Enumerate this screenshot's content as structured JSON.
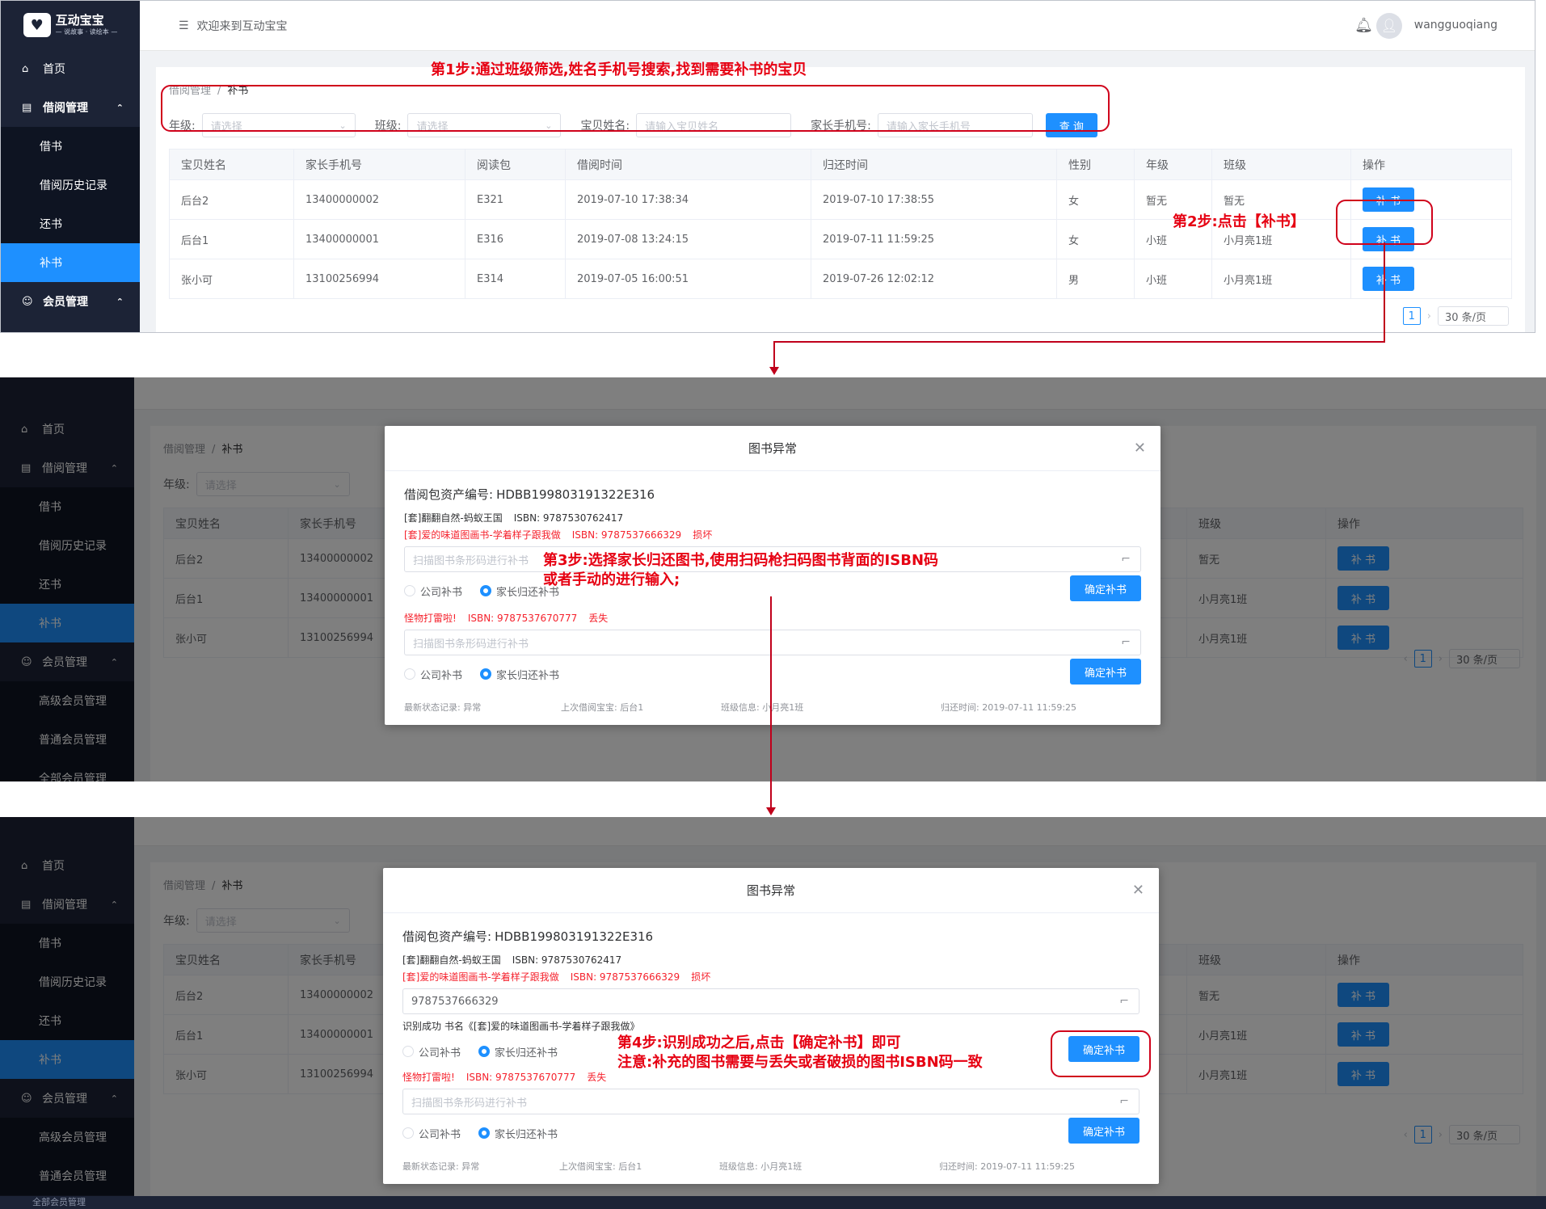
{
  "app": {
    "name": "互动宝宝",
    "slogan": "— 说故事 · 读绘本 —"
  },
  "topbar": {
    "welcome": "欢迎来到互动宝宝",
    "user": "wangguoqiang"
  },
  "sidebar": {
    "home": "首页",
    "borrow": "借阅管理",
    "borrow_sub": [
      "借书",
      "借阅历史记录",
      "还书",
      "补书"
    ],
    "member": "会员管理",
    "member_sub": [
      "高级会员管理",
      "普通会员管理",
      "全部会员管理"
    ]
  },
  "breadcrumb": {
    "parent": "借阅管理",
    "current": "补书",
    "sep": "/"
  },
  "filters": {
    "grade_label": "年级:",
    "grade_placeholder": "请选择",
    "class_label": "班级:",
    "class_placeholder": "请选择",
    "name_label": "宝贝姓名:",
    "name_placeholder": "请输入宝贝姓名",
    "phone_label": "家长手机号:",
    "phone_placeholder": "请输入家长手机号",
    "query": "查 询"
  },
  "table": {
    "headers": [
      "宝贝姓名",
      "家长手机号",
      "阅读包",
      "借阅时间",
      "归还时间",
      "性别",
      "年级",
      "班级",
      "操作"
    ],
    "rows": [
      {
        "name": "后台2",
        "phone": "13400000002",
        "pkg": "E321",
        "borrow": "2019-07-10 17:38:34",
        "return": "2019-07-10 17:38:55",
        "gender": "女",
        "grade": "暂无",
        "class": "暂无",
        "action": "补 书"
      },
      {
        "name": "后台1",
        "phone": "13400000001",
        "pkg": "E316",
        "borrow": "2019-07-08 13:24:15",
        "return": "2019-07-11 11:59:25",
        "gender": "女",
        "grade": "小班",
        "class": "小月亮1班",
        "action": "补 书"
      },
      {
        "name": "张小可",
        "phone": "13100256994",
        "pkg": "E314",
        "borrow": "2019-07-05 16:00:51",
        "return": "2019-07-26 12:02:12",
        "gender": "男",
        "grade": "小班",
        "class": "小月亮1班",
        "action": "补 书"
      }
    ]
  },
  "pager": {
    "page": "1",
    "size": "30 条/页"
  },
  "modal": {
    "title": "图书异常",
    "asset_label": "借阅包资产编号:",
    "asset_no": "HDBB199803191322E316",
    "book1": {
      "name": "[套]翻翻自然-蚂蚁王国",
      "isbn": "ISBN: 9787530762417"
    },
    "book2": {
      "name": "[套]爱的味道图画书-学着样子跟我做",
      "isbn": "ISBN: 9787537666329",
      "status": "损坏"
    },
    "book3": {
      "name": "怪物打雷啦!",
      "isbn": "ISBN: 9787537670777",
      "status": "丢失"
    },
    "scan_placeholder": "扫描图书条形码进行补书",
    "scan_value": "9787537666329",
    "ok_text": "识别成功 书名《[套]爱的味道图画书-学着样子跟我做》",
    "opt_company": "公司补书",
    "opt_parent": "家长归还补书",
    "confirm": "确定补书",
    "footer": {
      "status": "最新状态记录: 异常",
      "last": "上次借阅宝宝: 后台1",
      "class": "班级信息: 小月亮1班",
      "time": "归还时间: 2019-07-11 11:59:25"
    }
  },
  "annotations": {
    "step1": "第1步:通过班级筛选,姓名手机号搜索,找到需要补书的宝贝",
    "step2": "第2步:点击【补书】",
    "step3a": "第3步:选择家长归还图书,使用扫码枪扫码图书背面的ISBN码",
    "step3b": "或者手动的进行输入;",
    "step4a": "第4步:识别成功之后,点击【确定补书】即可",
    "step4b": "注意:补充的图书需要与丢失或者破损的图书ISBN码一致"
  },
  "colors": {
    "accent": "#1e90ff",
    "sidebar": "#1c2336",
    "annotation": "#e60012"
  }
}
